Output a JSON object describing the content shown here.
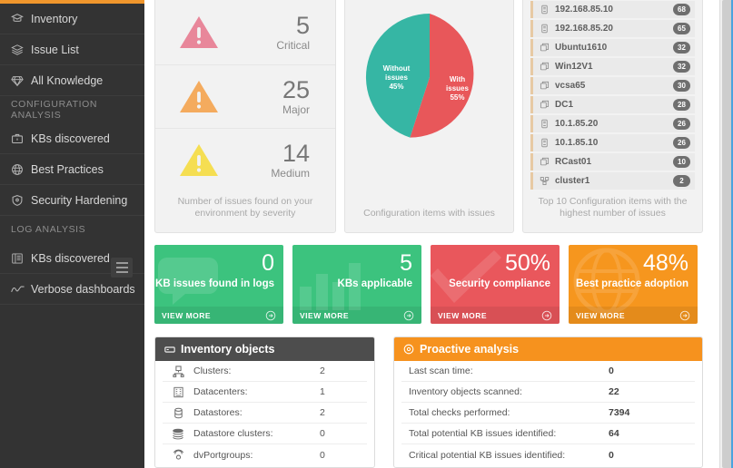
{
  "sidebar": {
    "accent_color": "#f0962c",
    "items": [
      {
        "label": "Inventory",
        "icon": "inventory-icon",
        "type": "item"
      },
      {
        "label": "Issue List",
        "icon": "layers-icon",
        "type": "item"
      },
      {
        "label": "All Knowledge",
        "icon": "diamond-icon",
        "type": "item"
      },
      {
        "label": "CONFIGURATION ANALYSIS",
        "icon": "",
        "type": "section"
      },
      {
        "label": "KBs discovered",
        "icon": "briefcase-icon",
        "type": "item"
      },
      {
        "label": "Best Practices",
        "icon": "globe-icon",
        "type": "item"
      },
      {
        "label": "Security Hardening",
        "icon": "shield-icon",
        "type": "item"
      },
      {
        "label": "LOG ANALYSIS",
        "icon": "",
        "type": "section"
      },
      {
        "label": "KBs discovered",
        "icon": "book-icon",
        "type": "item"
      },
      {
        "label": "Verbose dashboards",
        "icon": "trend-line-icon",
        "type": "item"
      }
    ],
    "collapse_button": "hamburger-icon"
  },
  "severity_panel": {
    "caption": "Number of issues found on your environment by severity",
    "rows": [
      {
        "count": "5",
        "label": "Critical",
        "color": "#e8879a",
        "icon": "warning-triangle-icon"
      },
      {
        "count": "25",
        "label": "Major",
        "color": "#f4ab5e",
        "icon": "warning-triangle-icon"
      },
      {
        "count": "14",
        "label": "Medium",
        "color": "#f5de52",
        "icon": "warning-triangle-icon"
      }
    ]
  },
  "pie_panel": {
    "caption": "Configuration items with issues"
  },
  "chart_data": {
    "type": "pie",
    "title": "Configuration items with issues",
    "labels": [
      "With issues",
      "Without issues"
    ],
    "values": [
      55,
      45
    ],
    "value_labels": [
      "55%",
      "45%"
    ],
    "colors": [
      "#e8575a",
      "#36b6a4"
    ],
    "legend": "in-slice",
    "slice_label_lines": [
      [
        "With",
        "issues",
        "55%"
      ],
      [
        "Without",
        "issues",
        "45%"
      ]
    ]
  },
  "top10_panel": {
    "caption": "Top 10 Configuration items with the highest number of issues",
    "rows": [
      {
        "name": "192.168.85.10",
        "count": "68",
        "icon": "host-server-icon"
      },
      {
        "name": "192.168.85.20",
        "count": "65",
        "icon": "host-server-icon"
      },
      {
        "name": "Ubuntu1610",
        "count": "32",
        "icon": "vm-icon"
      },
      {
        "name": "Win12V1",
        "count": "32",
        "icon": "vm-icon"
      },
      {
        "name": "vcsa65",
        "count": "30",
        "icon": "vm-icon"
      },
      {
        "name": "DC1",
        "count": "28",
        "icon": "vm-icon"
      },
      {
        "name": "10.1.85.20",
        "count": "26",
        "icon": "host-server-icon"
      },
      {
        "name": "10.1.85.10",
        "count": "26",
        "icon": "host-server-icon"
      },
      {
        "name": "RCast01",
        "count": "10",
        "icon": "vm-icon"
      },
      {
        "name": "cluster1",
        "count": "2",
        "icon": "cluster-icon"
      }
    ]
  },
  "kpi_cards": [
    {
      "value": "0",
      "label": "KB issues found in logs",
      "more": "VIEW MORE",
      "color": "#3cc37e",
      "watermark": "bubble-icon"
    },
    {
      "value": "5",
      "label": "KBs applicable",
      "more": "VIEW MORE",
      "color": "#3cc37e",
      "watermark": "bar-chart-icon"
    },
    {
      "value": "50%",
      "label": "Security compliance",
      "more": "VIEW MORE",
      "color": "#e9575c",
      "watermark": "check-icon"
    },
    {
      "value": "48%",
      "label": "Best practice adoption",
      "more": "VIEW MORE",
      "color": "#f6961e",
      "watermark": "globe-icon"
    }
  ],
  "inventory_panel": {
    "title": "Inventory objects",
    "title_icon": "server-rack-icon",
    "rows": [
      {
        "label": "Clusters:",
        "value": "2",
        "icon": "cluster-icon"
      },
      {
        "label": "Datacenters:",
        "value": "1",
        "icon": "datacenter-icon"
      },
      {
        "label": "Datastores:",
        "value": "2",
        "icon": "datastore-icon"
      },
      {
        "label": "Datastore clusters:",
        "value": "0",
        "icon": "datastore-cluster-icon"
      },
      {
        "label": "dvPortgroups:",
        "value": "0",
        "icon": "portgroup-icon"
      }
    ]
  },
  "proactive_panel": {
    "title": "Proactive analysis",
    "title_icon": "target-icon",
    "rows": [
      {
        "label": "Last scan time:",
        "value": "0"
      },
      {
        "label": "Inventory objects scanned:",
        "value": "22"
      },
      {
        "label": "Total checks performed:",
        "value": "7394"
      },
      {
        "label": "Total potential KB issues identified:",
        "value": "64"
      },
      {
        "label": "Critical potential KB issues identified:",
        "value": "0"
      }
    ]
  }
}
